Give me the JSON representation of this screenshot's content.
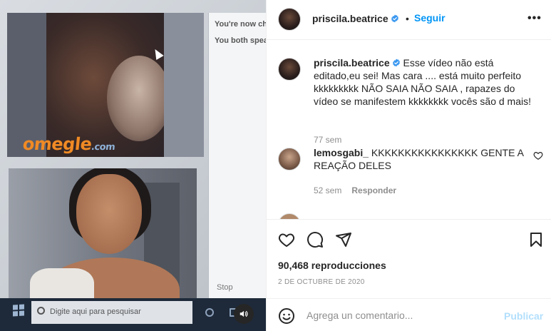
{
  "video": {
    "chat_lines": [
      "You're now ch",
      "You both spea"
    ],
    "logo": {
      "name": "omegle",
      "suffix": ".com"
    },
    "stop_label": "Stop",
    "taskbar_search_placeholder": "Digite aqui para pesquisar"
  },
  "post": {
    "author": "priscila.beatrice",
    "verified": true,
    "follow_label": "Seguir",
    "separator": "•",
    "more_label": "•••",
    "caption": {
      "text": "Esse vídeo não está editado,eu sei! Mas cara .... está muito perfeito kkkkkkkkk NÃO SAIA NÃO SAIA , rapazes do vídeo se manifestem kkkkkkkk vocês são d mais!",
      "time": "77 sem"
    },
    "comments": [
      {
        "user": "lemosgabi_",
        "text": "KKKKKKKKKKKKKKKK GENTE A REAÇÃO DELES",
        "time": "52 sem",
        "reply_label": "Responder"
      }
    ],
    "views": "90,468 reproducciones",
    "date": "2 DE OCTUBRE DE 2020",
    "add_comment_placeholder": "Agrega un comentario...",
    "publish_label": "Publicar"
  },
  "colors": {
    "accent": "#0095f6",
    "publish_disabled": "#b2dffc",
    "muted": "#8e8e8e",
    "omegle_orange": "#f08a24"
  },
  "icons": [
    "heart-icon",
    "comment-icon",
    "share-icon",
    "bookmark-icon",
    "emoji-icon",
    "verified-icon",
    "volume-icon"
  ]
}
